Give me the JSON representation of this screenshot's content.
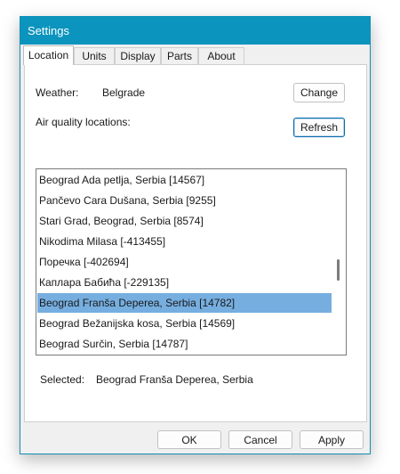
{
  "window": {
    "title": "Settings"
  },
  "tabs": [
    {
      "label": "Location"
    },
    {
      "label": "Units"
    },
    {
      "label": "Display"
    },
    {
      "label": "Parts"
    },
    {
      "label": "About"
    }
  ],
  "location": {
    "weather_label": "Weather:",
    "weather_value": "Belgrade",
    "change_label": "Change",
    "aq_label": "Air quality locations:",
    "refresh_label": "Refresh",
    "items": [
      {
        "text": "Beograd Ada petlja, Serbia [14567]"
      },
      {
        "text": "Pančevo Cara Dušana, Serbia [9255]"
      },
      {
        "text": "Stari Grad, Beograd, Serbia [8574]"
      },
      {
        "text": "Nikodima Milasa [-413455]"
      },
      {
        "text": "Поречка [-402694]"
      },
      {
        "text": "Каплара Бабића [-229135]"
      },
      {
        "text": "Beograd Franša Deperea, Serbia [14782]",
        "selected": true
      },
      {
        "text": "Beograd Bežanijska kosa, Serbia [14569]"
      },
      {
        "text": "Beograd Surčin, Serbia [14787]"
      }
    ],
    "selected_label": "Selected:",
    "selected_value": "Beograd Franša Deperea, Serbia"
  },
  "footer": {
    "ok_label": "OK",
    "cancel_label": "Cancel",
    "apply_label": "Apply"
  },
  "colors": {
    "titlebar": "#0b94bd",
    "selection": "#76aee0"
  },
  "scroll_position": 0.55
}
